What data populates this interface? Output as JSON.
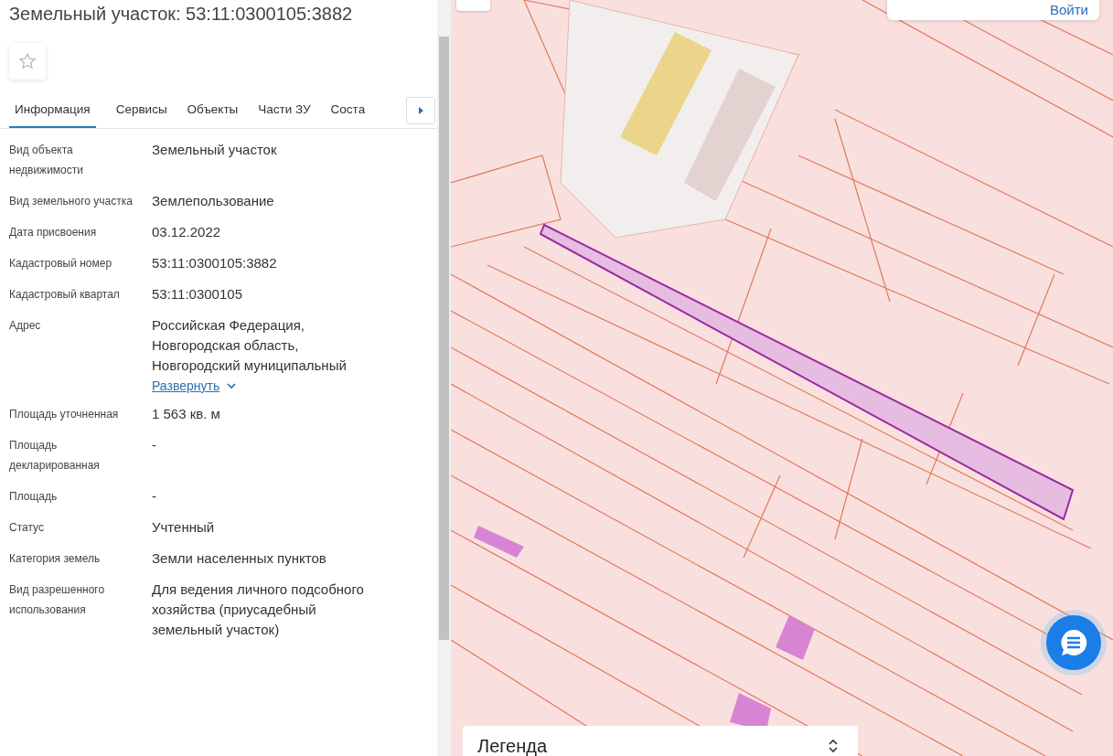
{
  "title": "Земельный участок: 53:11:0300105:3882",
  "favorite": {
    "on": false
  },
  "tabs": [
    {
      "label": "Информация",
      "selected": true
    },
    {
      "label": "Сервисы",
      "selected": false
    },
    {
      "label": "Объекты",
      "selected": false
    },
    {
      "label": "Части ЗУ",
      "selected": false
    },
    {
      "label": "Соста",
      "selected": false
    }
  ],
  "fields": [
    {
      "label": "Вид объекта недвижимости",
      "value": "Земельный участок"
    },
    {
      "label": "Вид земельного участка",
      "value": "Землепользование"
    },
    {
      "label": "Дата присвоения",
      "value": "03.12.2022"
    },
    {
      "label": "Кадастровый номер",
      "value": "53:11:0300105:3882"
    },
    {
      "label": "Кадастровый квартал",
      "value": "53:11:0300105"
    },
    {
      "label": "Адрес",
      "value": "Российская Федерация, Новгородская область, Новгородский муниципальный",
      "expand": "Развернуть"
    },
    {
      "label": "Площадь уточненная",
      "value": "1 563 кв. м"
    },
    {
      "label": "Площадь декларированная",
      "value": "-"
    },
    {
      "label": "Площадь",
      "value": "-"
    },
    {
      "label": "Статус",
      "value": "Учтенный"
    },
    {
      "label": "Категория земель",
      "value": "Земли населенных пунктов"
    },
    {
      "label": "Вид разрешенного использования",
      "value": "Для ведения личного подсобного хозяйства (приусадебный земельный участок)"
    }
  ],
  "map": {
    "login": "Войти",
    "legend": "Легенда"
  }
}
